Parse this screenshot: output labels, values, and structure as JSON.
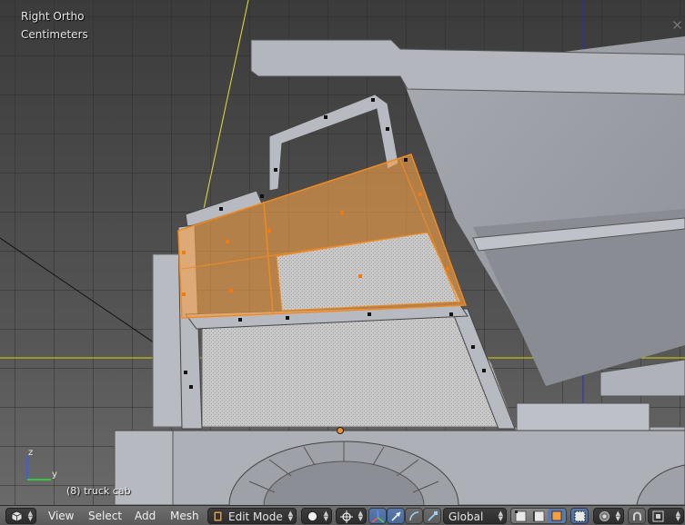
{
  "viewport": {
    "view_name": "Right Ortho",
    "units": "Centimeters",
    "object_info": "(8) truck cab"
  },
  "axes": {
    "z_label": "z",
    "y_label": "y"
  },
  "header": {
    "editor_type_icon": "cube-icon",
    "menus": {
      "view": "View",
      "select": "Select",
      "add": "Add",
      "mesh": "Mesh"
    },
    "mode": {
      "label": "Edit Mode",
      "icon": "edit-mode-icon"
    },
    "shading_icon": "sphere-shading-icon",
    "pivot_icon": "pivot-point-icon",
    "manipulator_icons": [
      "transform-axes-icon",
      "translate-icon",
      "rotate-icon",
      "scale-icon"
    ],
    "orientation": {
      "label": "Global"
    },
    "select_mode_icons": [
      "vertex-select-icon",
      "edge-select-icon",
      "face-select-icon"
    ],
    "occlude_icon": "limit-selection-icon",
    "proportional_icon": "proportional-edit-icon",
    "snap_icon": "magnet-icon"
  },
  "colors": {
    "selection_orange": "#f39a3a",
    "grid_line": "#4a4a4a",
    "y_axis_line": "#d8d800",
    "z_axis_line": "#2020c8",
    "header_bg": "#626262"
  }
}
